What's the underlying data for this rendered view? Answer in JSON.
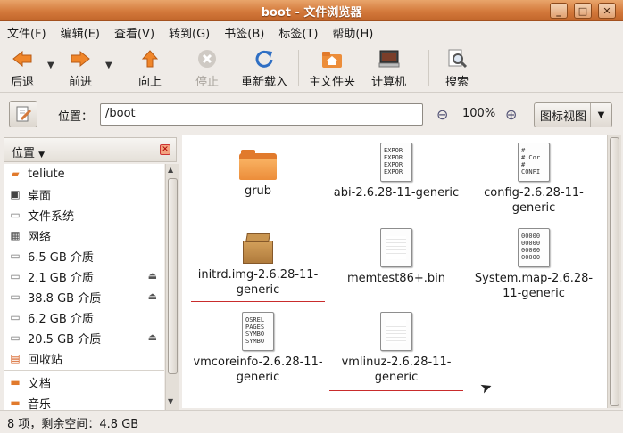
{
  "window": {
    "title": "boot - 文件浏览器",
    "min_label": "_",
    "max_label": "□",
    "close_label": "✕"
  },
  "menu": [
    "文件(F)",
    "编辑(E)",
    "查看(V)",
    "转到(G)",
    "书签(B)",
    "标签(T)",
    "帮助(H)"
  ],
  "toolbar": {
    "back": "后退",
    "forward": "前进",
    "up": "向上",
    "stop": "停止",
    "reload": "重新载入",
    "home": "主文件夹",
    "computer": "计算机",
    "search": "搜索"
  },
  "location": {
    "label": "位置：",
    "path": "/boot",
    "zoom": "100%",
    "view_mode": "图标视图"
  },
  "sidepane": {
    "title": "位置",
    "items": [
      {
        "label": "teliute",
        "icon": "home-icon"
      },
      {
        "label": "桌面",
        "icon": "desktop-icon"
      },
      {
        "label": "文件系统",
        "icon": "drive-icon"
      },
      {
        "label": "网络",
        "icon": "network-icon"
      },
      {
        "label": "6.5 GB 介质",
        "icon": "drive-icon"
      },
      {
        "label": "2.1 GB 介质",
        "icon": "drive-icon",
        "eject": true
      },
      {
        "label": "38.8 GB 介质",
        "icon": "drive-icon",
        "eject": true
      },
      {
        "label": "6.2 GB 介质",
        "icon": "drive-icon"
      },
      {
        "label": "20.5 GB 介质",
        "icon": "drive-icon",
        "eject": true
      },
      {
        "label": "回收站",
        "icon": "trash-icon"
      },
      {
        "label": "文档",
        "icon": "folder-icon"
      },
      {
        "label": "音乐",
        "icon": "folder-icon"
      }
    ]
  },
  "files": [
    {
      "name": "grub",
      "type": "folder"
    },
    {
      "name": "abi-2.6.28-11-generic",
      "type": "text",
      "preview": "EXPOR\nEXPOR\nEXPOR\nEXPOR"
    },
    {
      "name": "config-2.6.28-11-generic",
      "type": "text",
      "preview": "#\n# Cor\n#\nCONFI"
    },
    {
      "name": "initrd.img-2.6.28-11-generic",
      "type": "archive"
    },
    {
      "name": "memtest86+.bin",
      "type": "blank"
    },
    {
      "name": "System.map-2.6.28-11-generic",
      "type": "text",
      "preview": "00000\n00000\n00000\n00000"
    },
    {
      "name": "vmcoreinfo-2.6.28-11-generic",
      "type": "text",
      "preview": "OSREL\nPAGES\nSYMBO\nSYMBO"
    },
    {
      "name": "vmlinuz-2.6.28-11-generic",
      "type": "blank"
    }
  ],
  "status": "8 项，剩余空间：4.8 GB"
}
